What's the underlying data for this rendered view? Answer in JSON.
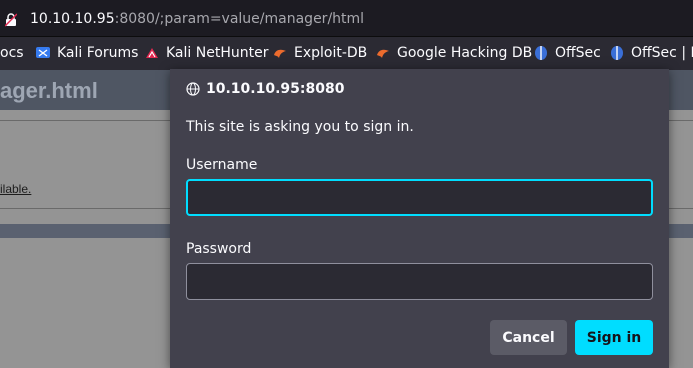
{
  "urlbar": {
    "host": "10.10.10.95",
    "rest": ":8080/;param=value/manager/html"
  },
  "bookmarks": [
    {
      "label": "ocs",
      "icon": "none"
    },
    {
      "label": "Kali Forums",
      "icon": "kali-forums-icon"
    },
    {
      "label": "Kali NetHunter",
      "icon": "kali-nethunter-icon"
    },
    {
      "label": "Exploit-DB",
      "icon": "exploit-db-icon"
    },
    {
      "label": "Google Hacking DB",
      "icon": "ghdb-icon"
    },
    {
      "label": "OffSec",
      "icon": "offsec-icon"
    },
    {
      "label": "OffSec | La",
      "icon": "offsec-icon"
    }
  ],
  "page": {
    "heading": "ager.html",
    "available_link": "ilable."
  },
  "dialog": {
    "origin": "10.10.10.95:8080",
    "message": "This site is asking you to sign in.",
    "username_label": "Username",
    "username_value": "",
    "password_label": "Password",
    "password_value": "",
    "cancel_label": "Cancel",
    "signin_label": "Sign in"
  },
  "colors": {
    "accent": "#00ddff",
    "dialog_bg": "#42414d",
    "toolbar_bg": "#2b2a33"
  }
}
